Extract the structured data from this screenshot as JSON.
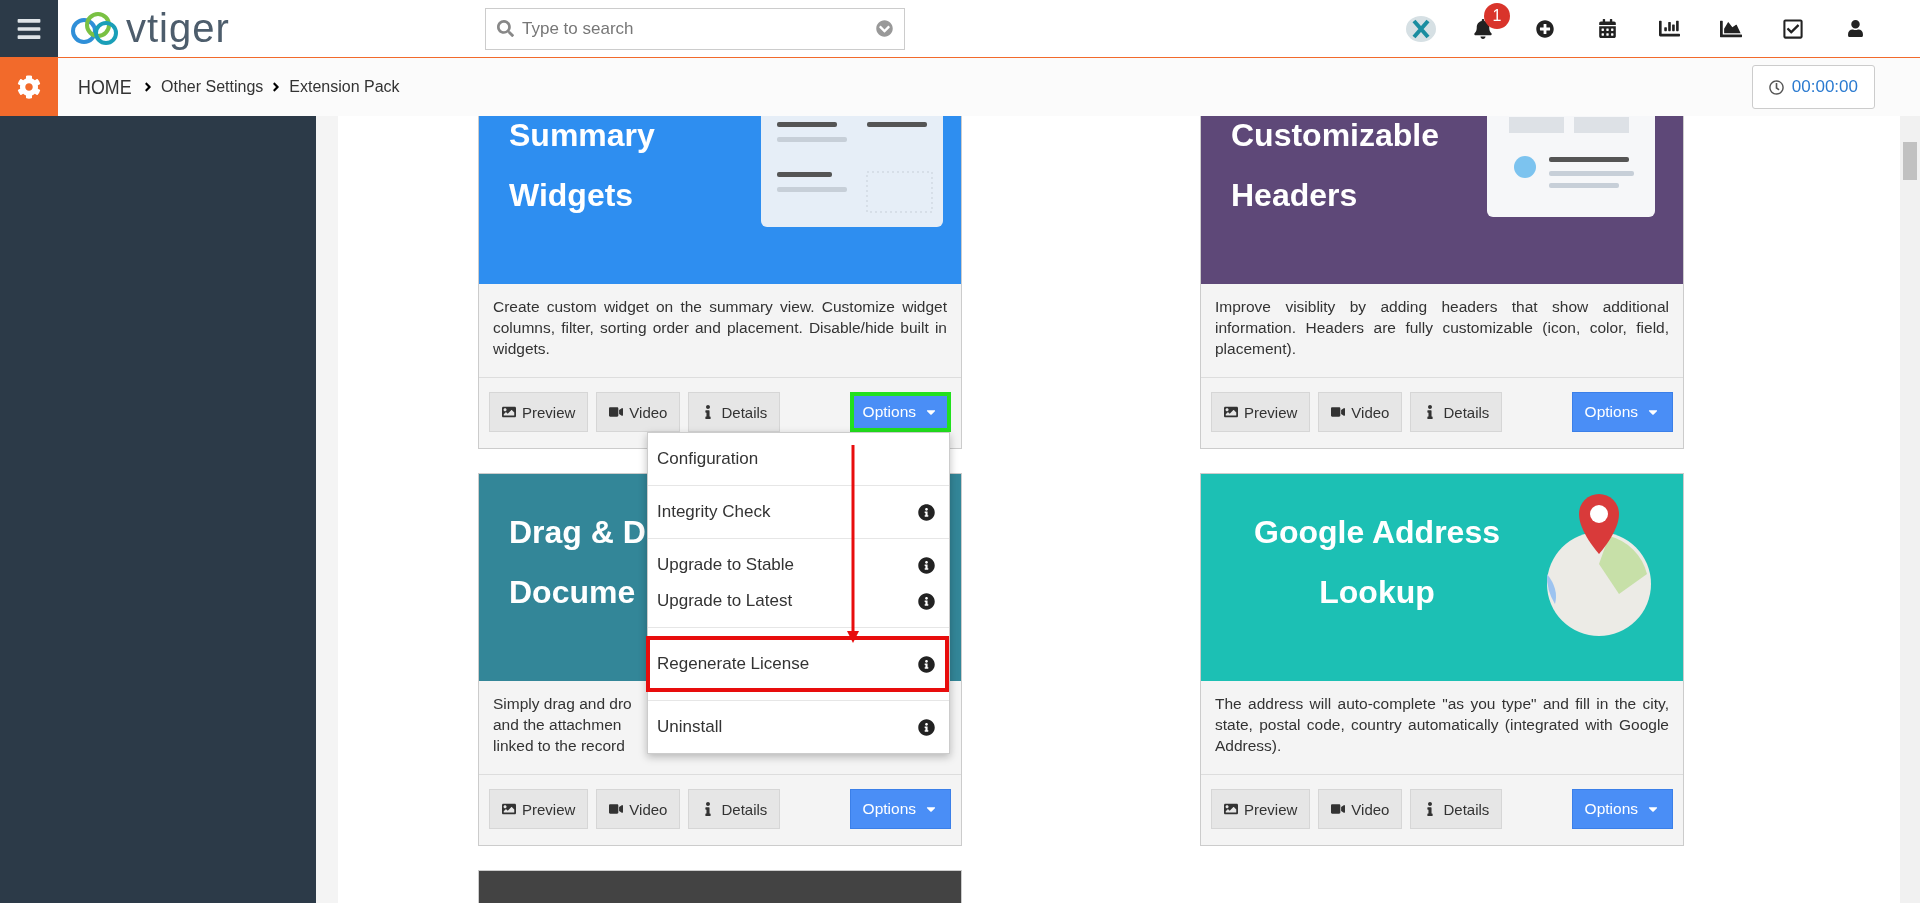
{
  "header": {
    "logo": "vtiger",
    "search": {
      "placeholder": "Type to search"
    },
    "notifications": {
      "count": "1"
    }
  },
  "breadcrumb": [
    "HOME",
    "Other Settings",
    "Extension Pack"
  ],
  "timer": "00:00:00",
  "cards": [
    {
      "title_lines": [
        "Summary",
        "Widgets"
      ],
      "color": "#2e8ef0",
      "kind": "widgets",
      "description": "Create custom widget on the summary view. Customize widget columns, filter, sorting order and placement. Disable/hide built in widgets.",
      "buttons": [
        "Preview",
        "Video",
        "Details"
      ],
      "options": {
        "label": "Options",
        "highlighted": true
      }
    },
    {
      "title_lines": [
        "Customizable",
        "Headers"
      ],
      "color": "#5e4878",
      "kind": "headers",
      "description": "Improve visiblity by adding headers that show additional information. Headers are fully customizable (icon, color, field, placement).",
      "buttons": [
        "Preview",
        "Video",
        "Details"
      ],
      "options": {
        "label": "Options",
        "highlighted": false
      }
    },
    {
      "title_lines": [
        "Drag & D",
        "Docume"
      ],
      "color": "#338698",
      "kind": "plain",
      "description_lines": [
        "Simply drag and dro",
        "and the attachmen",
        "linked to the record"
      ],
      "buttons": [
        "Preview",
        "Video",
        "Details"
      ],
      "options": {
        "label": "Options",
        "highlighted": false
      }
    },
    {
      "title_lines": [
        "Google Address",
        "Lookup"
      ],
      "color": "#1cc0b4",
      "kind": "map",
      "description": "The address will auto-complete \"as you type\" and fill in the city, state, postal code, country automatically (integrated with Google Address).",
      "buttons": [
        "Preview",
        "Video",
        "Details"
      ],
      "options": {
        "label": "Options",
        "highlighted": false
      }
    },
    {
      "color": "#434343",
      "kind": "plain"
    }
  ],
  "dropdown": {
    "groups": [
      [
        {
          "label": "Configuration",
          "info": false,
          "highlighted": false
        }
      ],
      [
        {
          "label": "Integrity Check",
          "info": true,
          "highlighted": false
        }
      ],
      [
        {
          "label": "Upgrade to Stable",
          "info": true,
          "highlighted": false
        },
        {
          "label": "Upgrade to Latest",
          "info": true,
          "highlighted": false
        }
      ],
      [
        {
          "label": "Regenerate License",
          "info": true,
          "highlighted": true
        }
      ],
      [
        {
          "label": "Uninstall",
          "info": true,
          "highlighted": false
        }
      ]
    ]
  }
}
